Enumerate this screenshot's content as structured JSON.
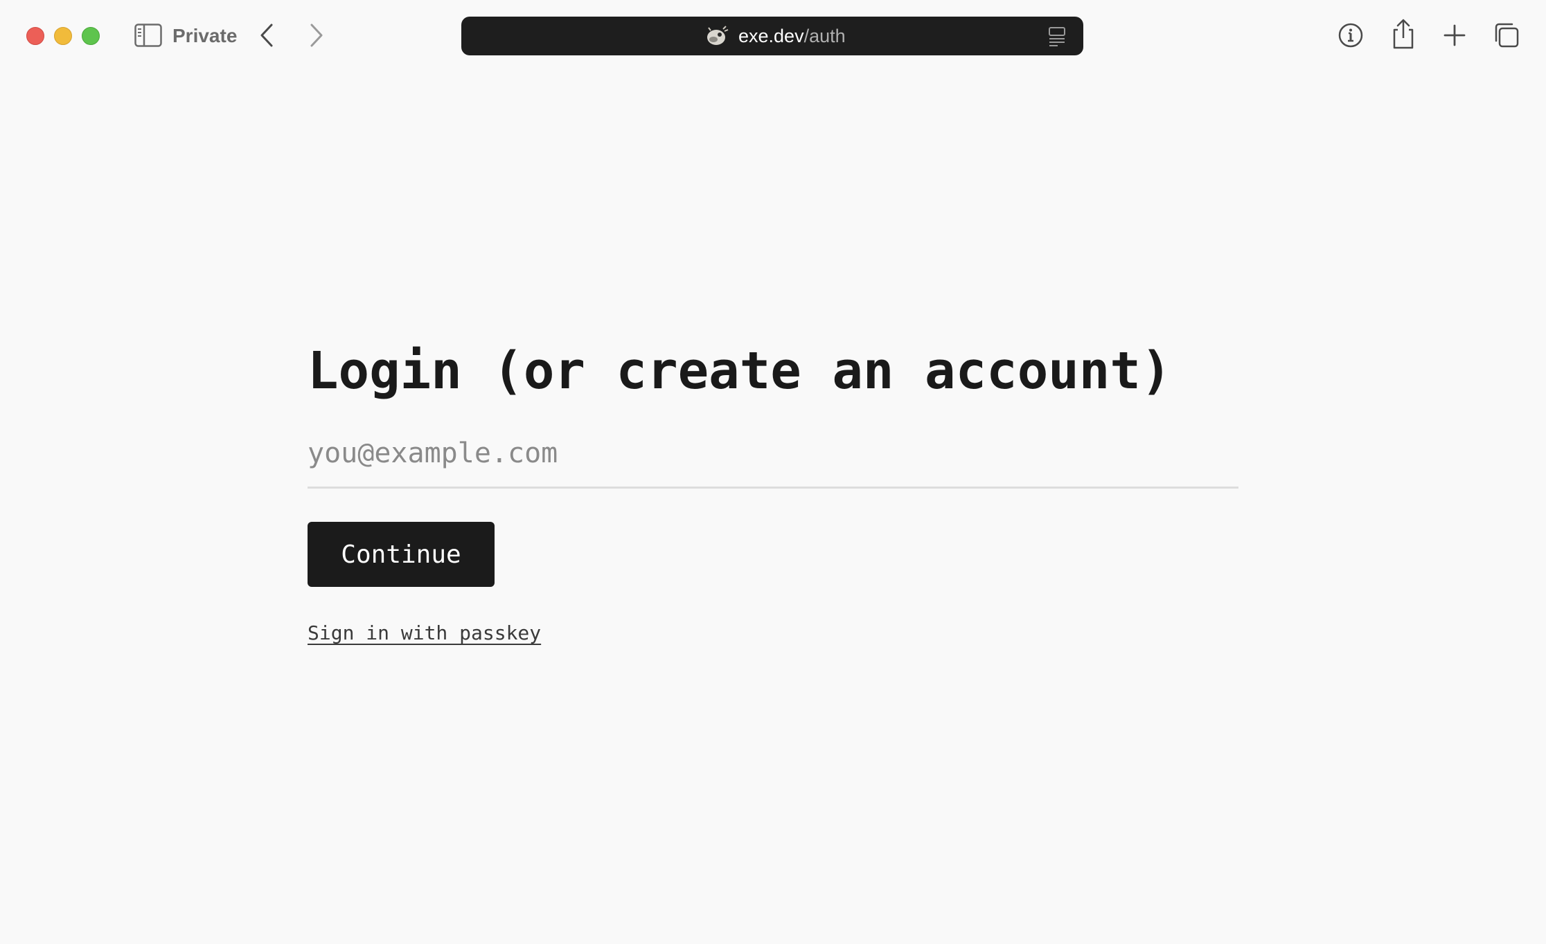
{
  "browser": {
    "mode_label": "Private",
    "url": {
      "host": "exe.dev",
      "path": "/auth"
    },
    "icons": {
      "sidebar": "sidebar-icon",
      "back": "chevron-left-icon",
      "forward": "chevron-right-icon",
      "site": "pufferfish-favicon",
      "reader": "reader-mode-icon",
      "info": "info-icon",
      "share": "share-icon",
      "new_tab": "plus-icon",
      "tabs": "tab-overview-icon"
    }
  },
  "page": {
    "title": "Login (or create an account)",
    "email": {
      "value": "",
      "placeholder": "you@example.com"
    },
    "continue_label": "Continue",
    "passkey_link": "Sign in with passkey"
  },
  "colors": {
    "background": "#f9f9f9",
    "button": "#1b1b1b",
    "urlbar": "#1e1e1e",
    "close": "#ec5f57",
    "minimize": "#f1bb3b",
    "zoom": "#5ec44d"
  }
}
